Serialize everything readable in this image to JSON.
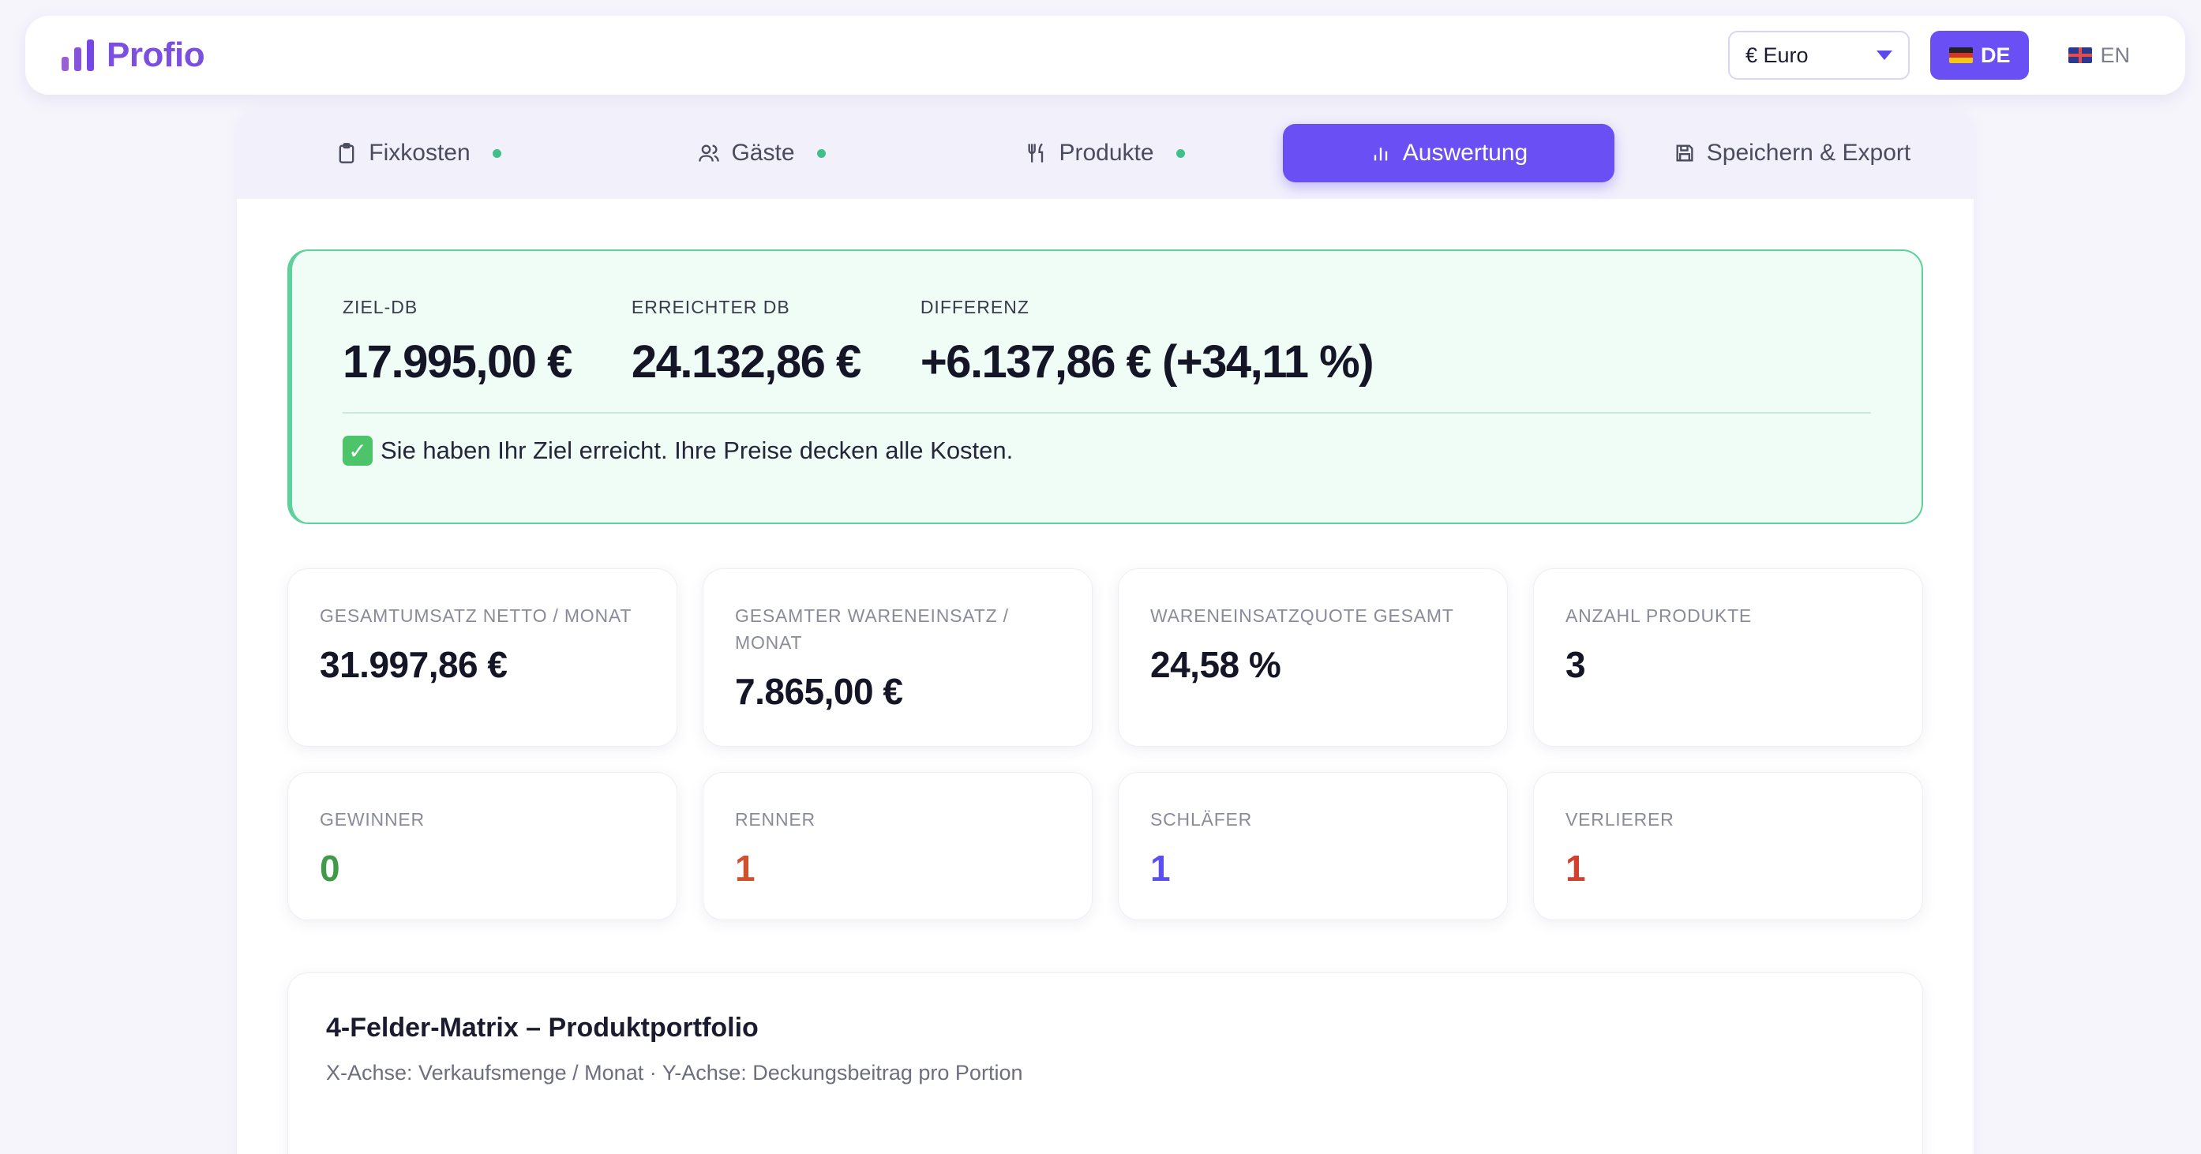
{
  "header": {
    "logo_text": "Profio",
    "currency": "€ Euro",
    "lang_de": "DE",
    "lang_en": "EN"
  },
  "tabs": [
    {
      "label": "Fixkosten",
      "icon": "clipboard-icon",
      "complete": true
    },
    {
      "label": "Gäste",
      "icon": "users-icon",
      "complete": true
    },
    {
      "label": "Produkte",
      "icon": "utensils-icon",
      "complete": true
    },
    {
      "label": "Auswertung",
      "icon": "bar-chart-icon",
      "active": true
    },
    {
      "label": "Speichern & Export",
      "icon": "save-icon"
    }
  ],
  "result": {
    "target_label": "ZIEL-DB",
    "target_value": "17.995,00 €",
    "achieved_label": "ERREICHTER DB",
    "achieved_value": "24.132,86 €",
    "diff_label": "DIFFERENZ",
    "diff_value": "+6.137,86 € (+34,11 %)",
    "message": "Sie haben Ihr Ziel erreicht. Ihre Preise decken alle Kosten."
  },
  "cards_row1": [
    {
      "label": "GESAMTUMSATZ NETTO / MONAT",
      "value": "31.997,86 €"
    },
    {
      "label": "GESAMTER WARENEINSATZ / MONAT",
      "value": "7.865,00 €"
    },
    {
      "label": "WARENEINSATZQUOTE GESAMT",
      "value": "24,58 %"
    },
    {
      "label": "ANZAHL PRODUKTE",
      "value": "3"
    }
  ],
  "cards_row2": [
    {
      "label": "GEWINNER",
      "value": "0",
      "color": "#3f9a4a"
    },
    {
      "label": "RENNER",
      "value": "1",
      "color": "#d0512f"
    },
    {
      "label": "SCHLÄFER",
      "value": "1",
      "color": "#5b4ff0"
    },
    {
      "label": "VERLIERER",
      "value": "1",
      "color": "#d0412f"
    }
  ],
  "matrix": {
    "title": "4-Felder-Matrix – Produktportfolio",
    "subtitle": "X-Achse: Verkaufsmenge / Monat · Y-Achse: Deckungsbeitrag pro Portion"
  }
}
